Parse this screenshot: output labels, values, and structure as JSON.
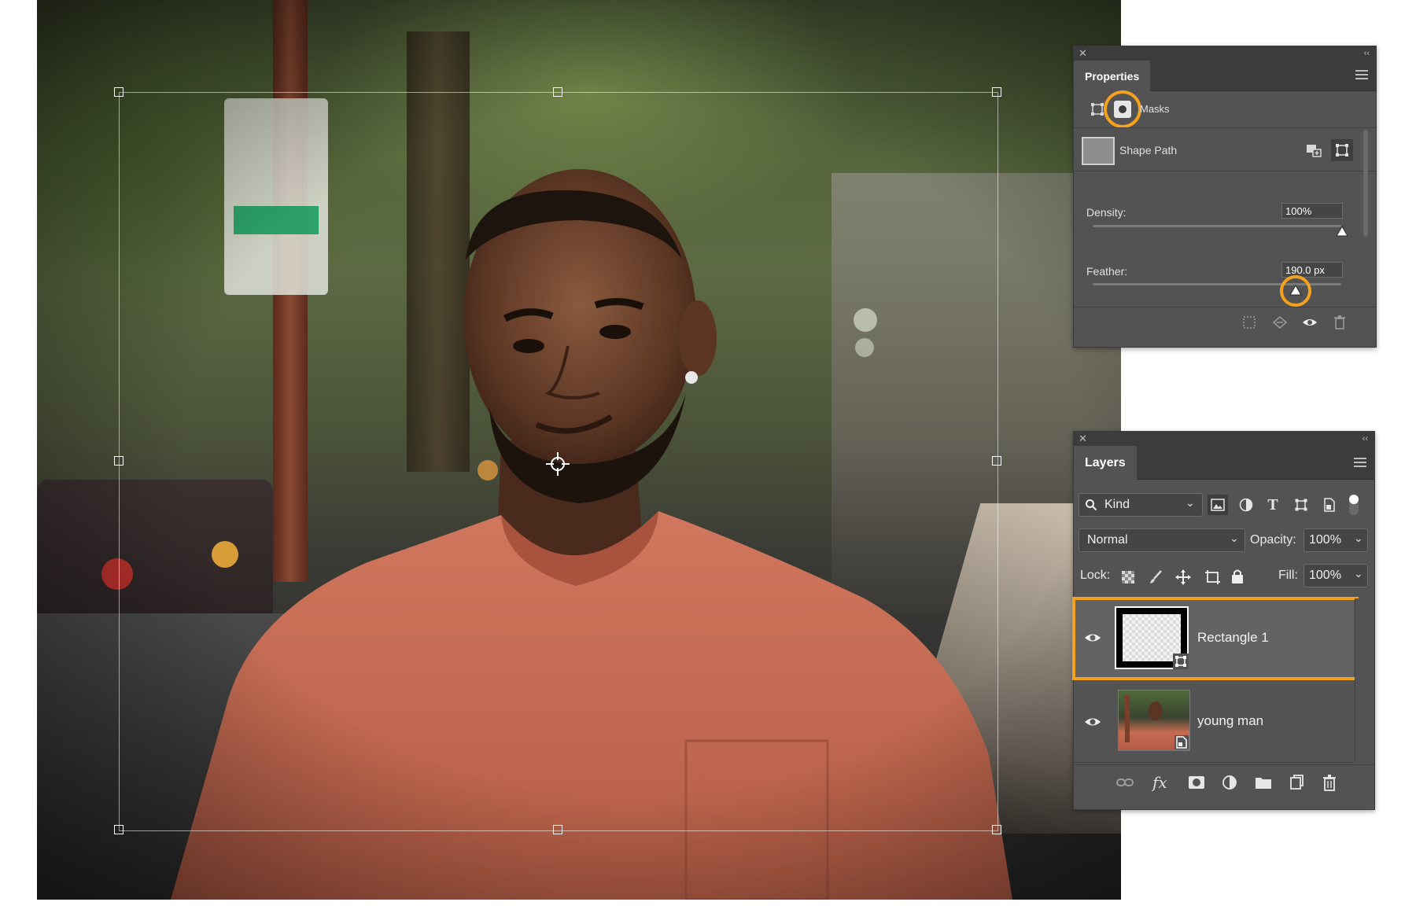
{
  "properties_panel": {
    "tab_title": "Properties",
    "masks_label": "Masks",
    "shape_path_label": "Shape Path",
    "density_label": "Density:",
    "density_value": "100%",
    "density_fraction": 1.0,
    "feather_label": "Feather:",
    "feather_value": "190.0 px",
    "feather_fraction": 0.8
  },
  "layers_panel": {
    "tab_title": "Layers",
    "filter_kind": "Kind",
    "blend_mode": "Normal",
    "opacity_label": "Opacity:",
    "opacity_value": "100%",
    "lock_label": "Lock:",
    "fill_label": "Fill:",
    "fill_value": "100%",
    "layers": [
      {
        "name": "Rectangle 1",
        "selected": true
      },
      {
        "name": "young man",
        "selected": false
      }
    ]
  },
  "colors": {
    "accent_highlight": "#f4a11f",
    "panel_bg": "#535353",
    "panel_header": "#3c3c3c"
  }
}
